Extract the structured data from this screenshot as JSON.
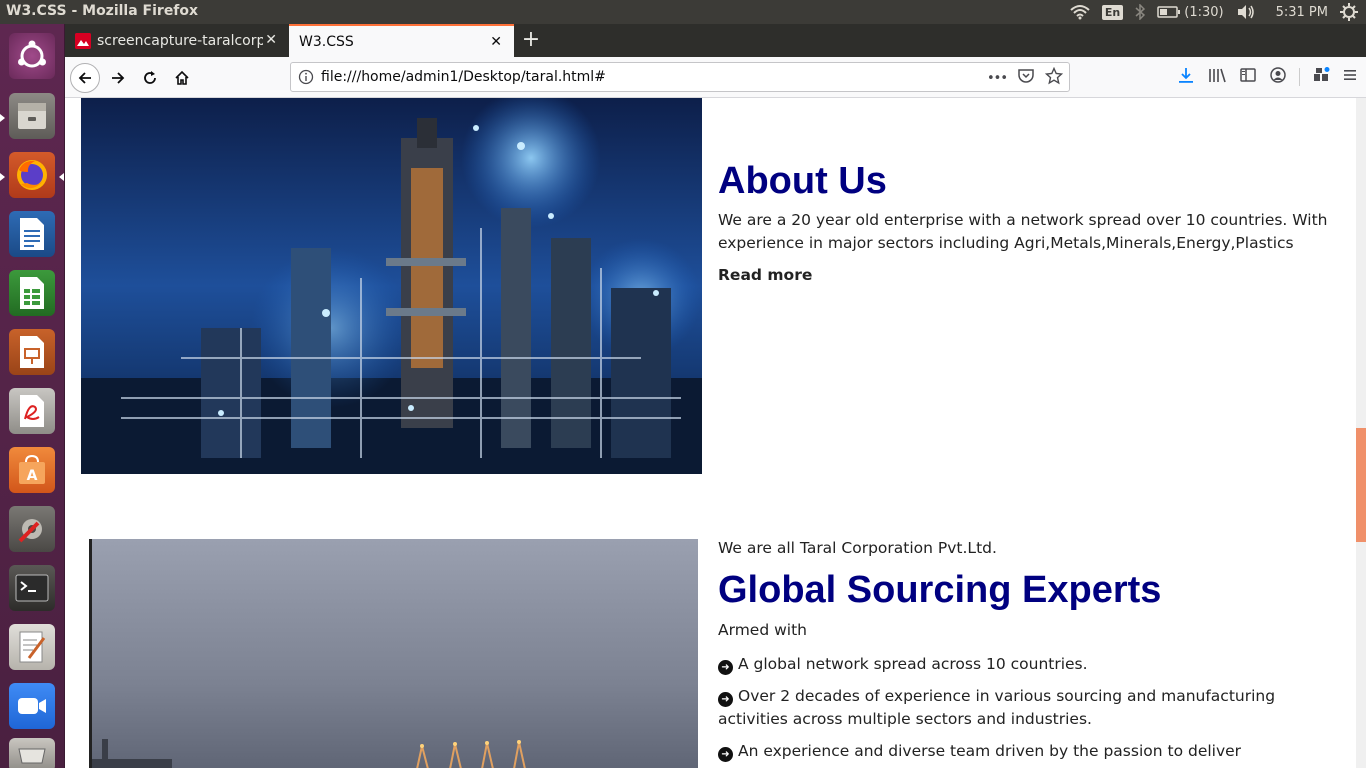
{
  "os": {
    "window_title": "W3.CSS - Mozilla Firefox",
    "keyboard_layout": "En",
    "battery": "(1:30)",
    "clock": "5:31 PM"
  },
  "launcher": {
    "items": [
      {
        "name": "ubuntu-dash-icon"
      },
      {
        "name": "files-icon"
      },
      {
        "name": "firefox-icon"
      },
      {
        "name": "libreoffice-writer-icon"
      },
      {
        "name": "libreoffice-calc-icon"
      },
      {
        "name": "libreoffice-impress-icon"
      },
      {
        "name": "document-viewer-icon"
      },
      {
        "name": "software-center-icon"
      },
      {
        "name": "system-settings-icon"
      },
      {
        "name": "terminal-icon"
      },
      {
        "name": "text-editor-icon"
      },
      {
        "name": "zoom-icon"
      },
      {
        "name": "trash-icon"
      }
    ]
  },
  "browser": {
    "tabs": [
      {
        "label": "screencapture-taralcorp",
        "active": false
      },
      {
        "label": "W3.CSS",
        "active": true
      }
    ],
    "new_tab": "+",
    "url": "file:///home/admin1/Desktop/taral.html#",
    "page_actions_more": "•••"
  },
  "page": {
    "about": {
      "title": "About Us",
      "text": "We are a 20 year old enterprise with a network spread over 10 countries. With experience in major sectors including Agri,Metals,Minerals,Energy,Plastics",
      "read_more": "Read more"
    },
    "sourcing": {
      "intro": "We are all Taral Corporation Pvt.Ltd.",
      "title": "Global Sourcing Experts",
      "armed": "Armed with",
      "bullets": [
        "A global network spread across 10 countries.",
        "Over 2 decades of experience in various sourcing and manufacturing activities across multiple sectors and industries.",
        "An experience and diverse team driven by the passion to deliver"
      ]
    }
  },
  "colors": {
    "heading": "#000080",
    "accent": "#ff7139",
    "launcher_bg": "#5e2750",
    "panel_bg": "#3c3b37"
  }
}
